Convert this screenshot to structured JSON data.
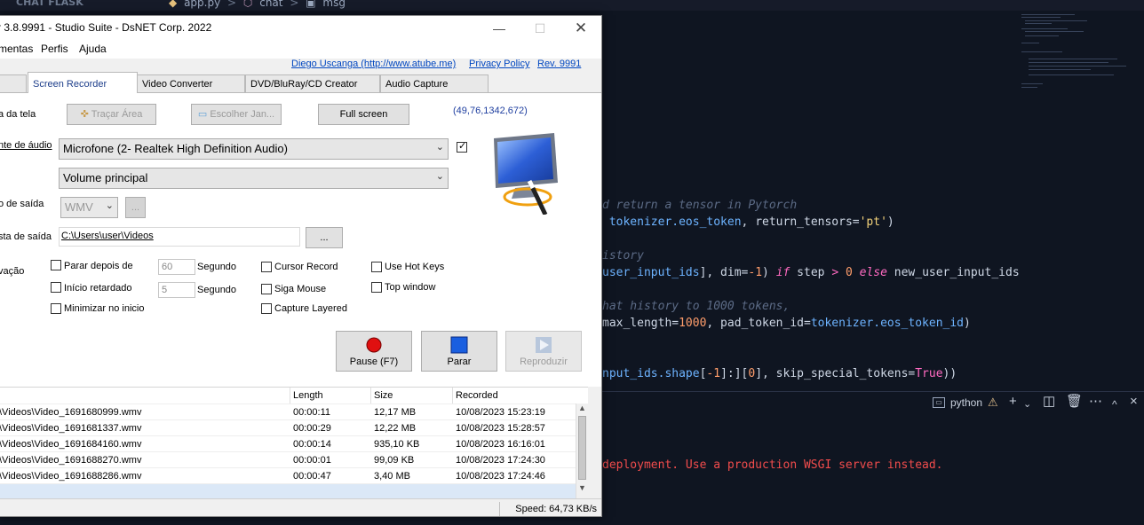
{
  "editor": {
    "section": "CHAT FLASK",
    "breadcrumb": [
      "app.py",
      ">",
      "chat",
      ">",
      "msg"
    ],
    "lines": [
      {
        "parts": [
          {
            "t": "d return a tensor in Pytorch",
            "c": "cm"
          }
        ]
      },
      {
        "parts": [
          {
            "t": " tokenizer.eos_token",
            "c": "bl"
          },
          {
            "t": ", return_tensors=",
            "c": ""
          },
          {
            "t": "'pt'",
            "c": "st"
          },
          {
            "t": ")",
            "c": ""
          }
        ]
      },
      {
        "parts": [
          {
            "t": "istory",
            "c": "cm"
          }
        ]
      },
      {
        "parts": [
          {
            "t": "user_input_ids",
            "c": "bl"
          },
          {
            "t": "], dim=",
            "c": ""
          },
          {
            "t": "-1",
            "c": "nm"
          },
          {
            "t": ") ",
            "c": ""
          },
          {
            "t": "if",
            "c": "kw"
          },
          {
            "t": " step ",
            "c": ""
          },
          {
            "t": ">",
            "c": "op"
          },
          {
            "t": " 0 ",
            "c": "nm"
          },
          {
            "t": "else",
            "c": "kw"
          },
          {
            "t": " new_user_input_ids",
            "c": ""
          }
        ]
      },
      {
        "parts": [
          {
            "t": "hat history to 1000 tokens,",
            "c": "cm"
          }
        ]
      },
      {
        "parts": [
          {
            "t": "max_length=",
            "c": ""
          },
          {
            "t": "1000",
            "c": "nm"
          },
          {
            "t": ", pad_token_id=",
            "c": ""
          },
          {
            "t": "tokenizer.eos_token_id",
            "c": "bl"
          },
          {
            "t": ")",
            "c": ""
          }
        ]
      },
      {
        "parts": [
          {
            "t": "nput_ids.shape",
            "c": "bl"
          },
          {
            "t": "[",
            "c": ""
          },
          {
            "t": "-1",
            "c": "nm"
          },
          {
            "t": "]:][",
            "c": ""
          },
          {
            "t": "0",
            "c": "nm"
          },
          {
            "t": "], skip_special_tokens=",
            "c": ""
          },
          {
            "t": "True",
            "c": "tr"
          },
          {
            "t": "))",
            "c": ""
          }
        ]
      }
    ],
    "terminal_label": "python",
    "error_line": "deployment. Use a production WSGI server instead."
  },
  "window": {
    "title": "r 3.8.9991 - Studio Suite - DsNET Corp. 2022",
    "menu": [
      "mentas",
      "Perfis",
      "Ajuda"
    ],
    "links": [
      "Diego Uscanga (http://www.atube.me)",
      "Privacy Policy",
      "Rev. 9991"
    ],
    "tabs": [
      "Screen Recorder",
      "Video Converter",
      "DVD/BluRay/CD Creator",
      "Audio Capture"
    ],
    "labels": {
      "area": "a da tela",
      "audio": "nte de áudio",
      "output_format": "o de saída",
      "output_folder": "sta de saída",
      "options": "vação"
    },
    "buttons": {
      "trace_area": "Traçar Área",
      "choose_window": "Escolher Jan...",
      "full_screen": "Full screen",
      "browse_format": "...",
      "browse_folder": "..."
    },
    "coords": "(49,76,1342,672)",
    "audio_device": "Microfone (2- Realtek High Definition Audio)",
    "volume": "Volume principal",
    "format": "WMV",
    "folder": "C:\\Users\\user\\Videos",
    "checks": {
      "stop_after": "Parar depois de",
      "delayed_start": "Início retardado",
      "minimize": "Minimizar no inicio",
      "cursor": "Cursor Record",
      "follow_mouse": "Siga Mouse",
      "layered": "Capture Layered",
      "hotkeys": "Use Hot Keys",
      "topwindow": "Top window"
    },
    "stop_after_value": "60",
    "delay_value": "5",
    "unit": "Segundo",
    "controls": {
      "pause": "Pause (F7)",
      "stop": "Parar",
      "play": "Reproduzir"
    },
    "list_headers": [
      "Length",
      "Size",
      "Recorded"
    ],
    "files": [
      {
        "name": "\\Videos\\Video_1691680999.wmv",
        "length": "00:00:11",
        "size": "12,17 MB",
        "recorded": "10/08/2023 15:23:19"
      },
      {
        "name": "\\Videos\\Video_1691681337.wmv",
        "length": "00:00:29",
        "size": "12,22 MB",
        "recorded": "10/08/2023 15:28:57"
      },
      {
        "name": "\\Videos\\Video_1691684160.wmv",
        "length": "00:00:14",
        "size": "935,10 KB",
        "recorded": "10/08/2023 16:16:01"
      },
      {
        "name": "\\Videos\\Video_1691688270.wmv",
        "length": "00:00:01",
        "size": "99,09 KB",
        "recorded": "10/08/2023 17:24:30"
      },
      {
        "name": "\\Videos\\Video_1691688286.wmv",
        "length": "00:00:47",
        "size": "3,40 MB",
        "recorded": "10/08/2023 17:24:46"
      }
    ],
    "status": "Speed: 64,73 KB/s"
  }
}
